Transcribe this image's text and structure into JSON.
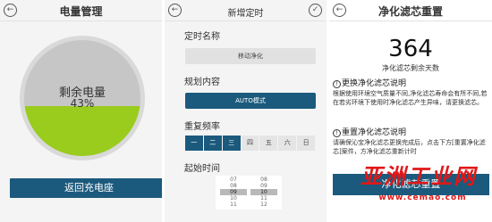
{
  "screen1": {
    "title": "电量管理",
    "back_icon": "back-arrow-icon",
    "gauge_label": "剩余电量",
    "gauge_value": "43%",
    "gauge_fraction": 0.43,
    "gauge_fill_color": "#99cc1c",
    "button_label": "返回充电座"
  },
  "screen2": {
    "title": "新增定时",
    "back_icon": "back-arrow-icon",
    "confirm_icon": "check-circle-icon",
    "name_label": "定时名称",
    "name_value": "移动净化",
    "plan_label": "规划内容",
    "plan_value": "AUTO模式",
    "repeat_label": "重复频率",
    "weekdays": [
      "一",
      "二",
      "三",
      "四",
      "五",
      "六",
      "日"
    ],
    "weekdays_active": [
      true,
      true,
      true,
      false,
      false,
      false,
      false
    ],
    "start_label": "起始时间",
    "hours": [
      "07",
      "08",
      "09",
      "10",
      "11"
    ],
    "minutes": [
      "08",
      "09",
      "10",
      "11",
      "12"
    ],
    "selected_index": 2
  },
  "screen3": {
    "title": "净化滤芯重置",
    "back_icon": "back-arrow-icon",
    "days_value": "364",
    "days_caption": "净化滤芯剩余天数",
    "replace_title": "更换净化滤芯说明",
    "replace_text": "根据使用环境空气质量不同,净化滤芯寿命会有所不同,若在若劣环境下使用时净化滤芯产生异味，请更换滤芯。",
    "reset_title": "重置净化滤芯说明",
    "reset_text": "请确保沁宝净化滤芯更换完成后，点击下方[重置净化滤芯]案件，方净化滤芯重新计时",
    "button_label": "净化滤芯重置"
  },
  "watermark": {
    "main": "亚洲工业网",
    "url": "www.cemao.com"
  },
  "colors": {
    "accent": "#1b5a7d",
    "watermark": "#e01818"
  }
}
